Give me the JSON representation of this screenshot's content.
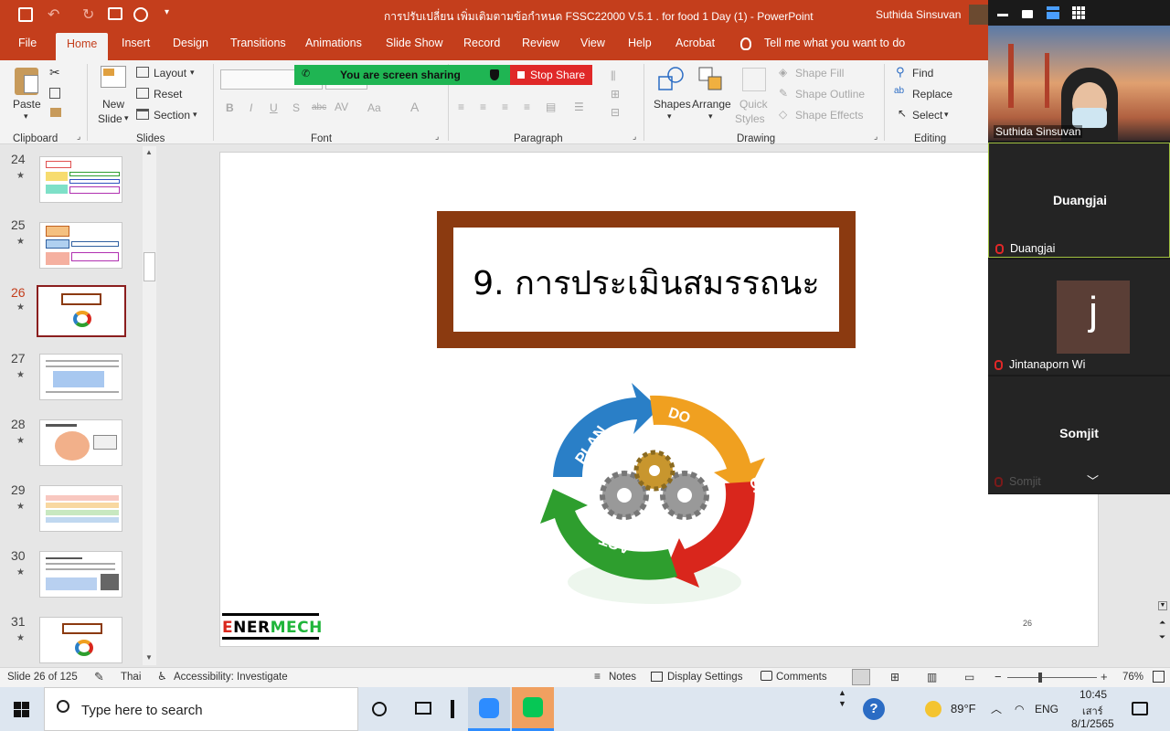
{
  "title_bar": {
    "doc_title": "การปรับเปลี่ยน เพิ่มเติมตามข้อกำหนด FSSC22000 V.5.1 . for food 1 Day (1)  -  PowerPoint",
    "user_name": "Suthida Sinsuvan"
  },
  "tabs": [
    "File",
    "Home",
    "Insert",
    "Design",
    "Transitions",
    "Animations",
    "Slide Show",
    "Record",
    "Review",
    "View",
    "Help",
    "Acrobat"
  ],
  "tell_me": "Tell me what you want to do",
  "share_bar": {
    "status": "You are screen sharing",
    "stop": "Stop Share"
  },
  "ribbon": {
    "clipboard": {
      "paste": "Paste",
      "group": "Clipboard"
    },
    "slides": {
      "new_slide_1": "New",
      "new_slide_2": "Slide",
      "layout": "Layout",
      "reset": "Reset",
      "section": "Section",
      "group": "Slides"
    },
    "font": {
      "group": "Font",
      "bold": "B",
      "italic": "I",
      "underline": "U",
      "shadow": "S",
      "strike": "abc",
      "aa": "Aa"
    },
    "paragraph": {
      "group": "Paragraph"
    },
    "drawing": {
      "shapes": "Shapes",
      "arrange": "Arrange",
      "quick_styles_1": "Quick",
      "quick_styles_2": "Styles",
      "shape_fill": "Shape Fill",
      "shape_outline": "Shape Outline",
      "shape_effects": "Shape Effects",
      "group": "Drawing"
    },
    "editing": {
      "find": "Find",
      "replace": "Replace",
      "select": "Select",
      "group": "Editing"
    }
  },
  "thumbnails": [
    {
      "num": "24",
      "selected": false
    },
    {
      "num": "25",
      "selected": false
    },
    {
      "num": "26",
      "selected": true
    },
    {
      "num": "27",
      "selected": false
    },
    {
      "num": "28",
      "selected": false
    },
    {
      "num": "29",
      "selected": false
    },
    {
      "num": "30",
      "selected": false
    },
    {
      "num": "31",
      "selected": false
    }
  ],
  "slide": {
    "title": "9. การประเมินสมรรถนะ",
    "cycle": [
      "PLAN",
      "DO",
      "CHECK",
      "ACT"
    ],
    "logo_red": "E",
    "logo_black": "NER",
    "logo_green": "MECH",
    "page_number": "26",
    "colors": {
      "frame": "#8b3a10",
      "plan": "#2a7fc7",
      "do": "#f0a020",
      "check": "#d9261c",
      "act": "#2e9e2e"
    }
  },
  "status_bar": {
    "slide_info": "Slide 26 of 125",
    "language": "Thai",
    "accessibility": "Accessibility: Investigate",
    "notes": "Notes",
    "display": "Display Settings",
    "comments": "Comments",
    "zoom": "76%"
  },
  "taskbar": {
    "search_placeholder": "Type here to search",
    "temperature": "89°F",
    "lang": "ENG",
    "time": "10:45",
    "day": "เสาร์",
    "date": "8/1/2565"
  },
  "zoom_panel": {
    "participants": [
      {
        "name": "Suthida Sinsuvan",
        "type": "video"
      },
      {
        "name": "Duangjai",
        "type": "name"
      },
      {
        "name": "Jintanaporn Wi",
        "type": "avatar",
        "initial": "j"
      },
      {
        "name": "Somjit",
        "type": "name"
      }
    ]
  }
}
